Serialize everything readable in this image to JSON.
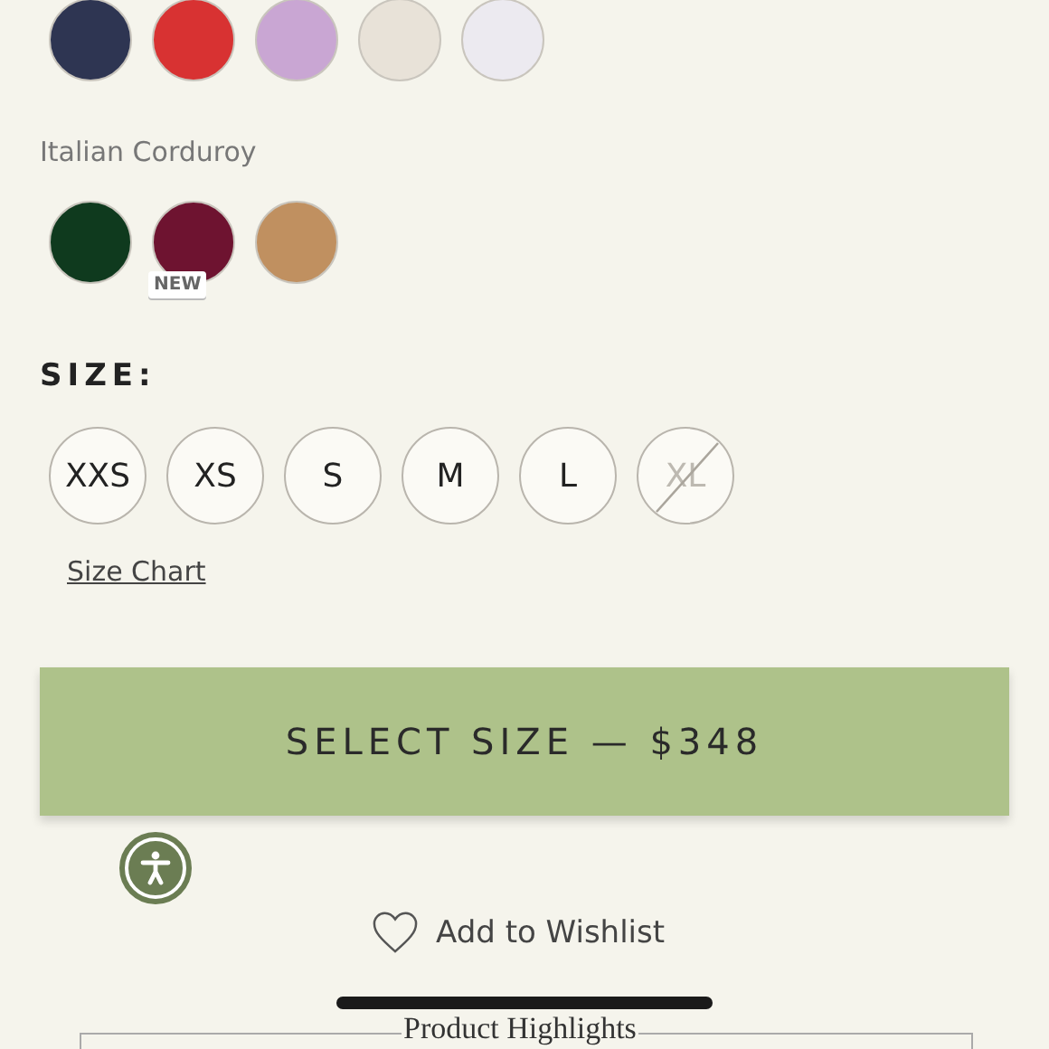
{
  "swatch_groups": [
    {
      "swatches": [
        {
          "color": "#2e3552"
        },
        {
          "color": "#d83232"
        },
        {
          "color": "#c9a6d3"
        },
        {
          "color": "#e8e2d8"
        },
        {
          "color": "#eceaf0"
        }
      ]
    },
    {
      "label": "Italian Corduroy",
      "swatches": [
        {
          "color": "#0f3a1e"
        },
        {
          "color": "#6e1330",
          "badge": "NEW"
        },
        {
          "color": "#c09060"
        }
      ]
    }
  ],
  "size_label": "SIZE:",
  "sizes": [
    {
      "label": "XXS",
      "available": true
    },
    {
      "label": "XS",
      "available": true
    },
    {
      "label": "S",
      "available": true
    },
    {
      "label": "M",
      "available": true
    },
    {
      "label": "L",
      "available": true
    },
    {
      "label": "XL",
      "available": false
    }
  ],
  "size_chart_link": "Size Chart",
  "cta_button": "SELECT SIZE — $348",
  "wishlist_link": "Add to Wishlist",
  "section_title": "Product Highlights"
}
